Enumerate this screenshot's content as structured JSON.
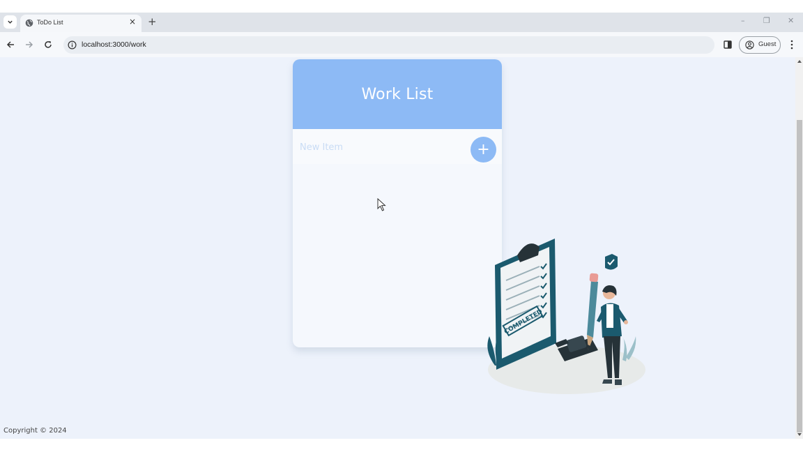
{
  "browser": {
    "tab_title": "ToDo List",
    "tab_close": "×",
    "new_tab": "+",
    "url": "localhost:3000/work",
    "profile_label": "Guest",
    "window_minimize": "–",
    "window_restore": "❐",
    "window_close": "✕"
  },
  "card": {
    "title": "Work List",
    "input_placeholder": "New Item",
    "input_value": "",
    "add_button_label": "+"
  },
  "illustration": {
    "stamp_text": "COMPLETED"
  },
  "footer": {
    "copyright": "Copyright © 2024"
  },
  "colors": {
    "accent": "#8dbaf5",
    "page_background": "#edf2fb",
    "card_background": "#f5f8fd",
    "illustration_teal": "#1b5a6e"
  }
}
